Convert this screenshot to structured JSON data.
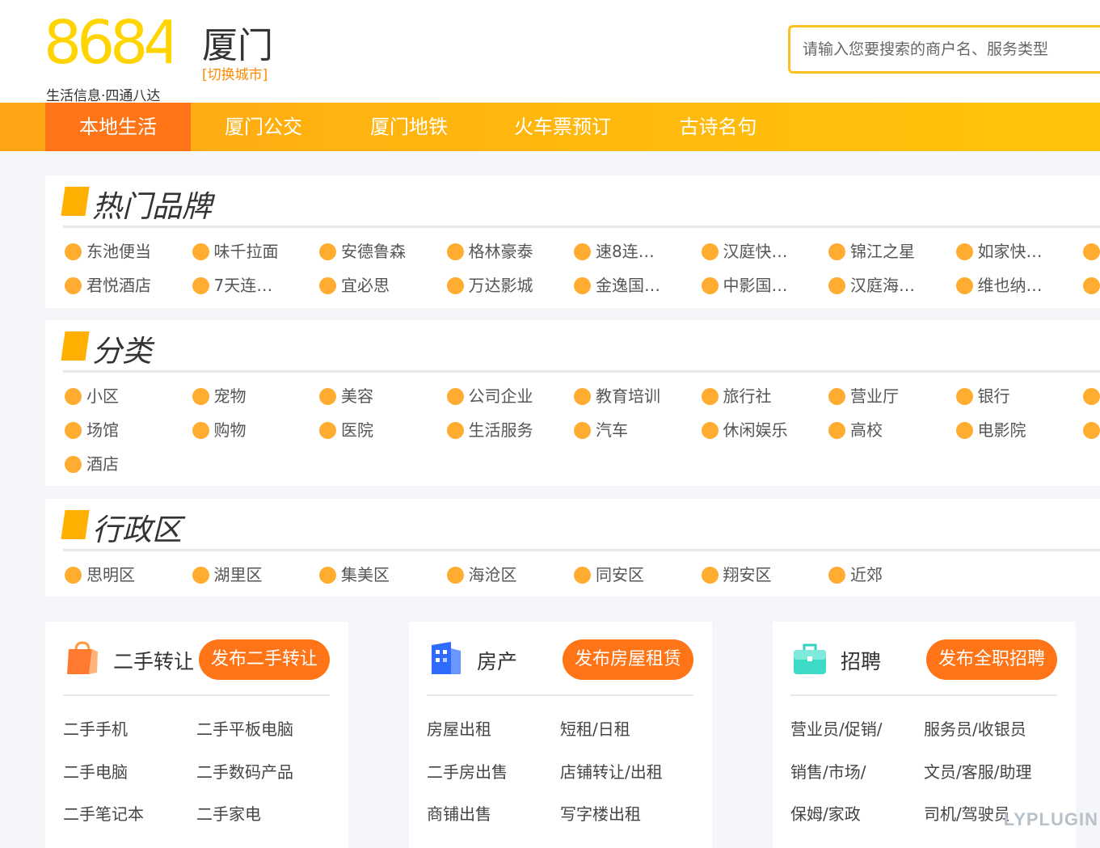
{
  "header": {
    "logo_number": "8684",
    "logo_slogan": "生活信息·四通八达",
    "city_name": "厦门",
    "city_switch": "[切换城市]",
    "search_placeholder": "请输入您要搜索的商户名、服务类型"
  },
  "colors": {
    "accent_orange": "#ff7417",
    "nav_yellow": "#ffc40a",
    "dot_orange": "#ffac30",
    "logo_yellow": "#ffd400"
  },
  "nav": {
    "items": [
      {
        "label": "本地生活",
        "active": true
      },
      {
        "label": "厦门公交"
      },
      {
        "label": "厦门地铁"
      },
      {
        "label": "火车票预订"
      },
      {
        "label": "古诗名句"
      }
    ]
  },
  "brands": {
    "title": "热门品牌",
    "items": [
      "东池便当",
      "味千拉面",
      "安德鲁森",
      "格林豪泰",
      "速8连…",
      "汉庭快…",
      "锦江之星",
      "如家快…",
      "君悦酒店",
      "7天连…",
      "宜必思",
      "万达影城",
      "金逸国…",
      "中影国…",
      "汉庭海…",
      "维也纳…"
    ]
  },
  "categories": {
    "title": "分类",
    "items": [
      "小区",
      "宠物",
      "美容",
      "公司企业",
      "教育培训",
      "旅行社",
      "营业厅",
      "银行",
      "场馆",
      "购物",
      "医院",
      "生活服务",
      "汽车",
      "休闲娱乐",
      "高校",
      "电影院",
      "酒店"
    ]
  },
  "districts": {
    "title": "行政区",
    "items": [
      "思明区",
      "湖里区",
      "集美区",
      "海沧区",
      "同安区",
      "翔安区",
      "近郊"
    ]
  },
  "cards": [
    {
      "icon": "shopping-bag-icon",
      "title": "二手转让",
      "button": "发布二手转让",
      "links": [
        "二手手机",
        "二手平板电脑",
        "二手电脑",
        "二手数码产品",
        "二手笔记本",
        "二手家电"
      ]
    },
    {
      "icon": "building-icon",
      "title": "房产",
      "button": "发布房屋租赁",
      "links": [
        "房屋出租",
        "短租/日租",
        "二手房出售",
        "店铺转让/出租",
        "商铺出售",
        "写字楼出租"
      ]
    },
    {
      "icon": "briefcase-icon",
      "title": "招聘",
      "button": "发布全职招聘",
      "links": [
        "营业员/促销/",
        "服务员/收银员",
        "销售/市场/",
        "文员/客服/助理",
        "保姆/家政",
        "司机/驾驶员"
      ]
    }
  ],
  "watermark": "LYPLUGIN"
}
